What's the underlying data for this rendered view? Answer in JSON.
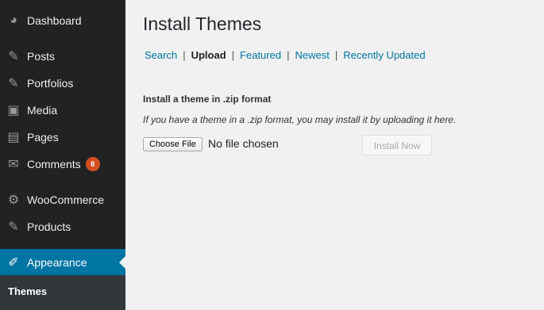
{
  "sidebar": {
    "items": [
      {
        "label": "Dashboard",
        "icon": "dashboard-icon",
        "glyph": "◕"
      },
      {
        "label": "Posts",
        "icon": "pin-icon",
        "glyph": "✎"
      },
      {
        "label": "Portfolios",
        "icon": "pin-icon",
        "glyph": "✎"
      },
      {
        "label": "Media",
        "icon": "media-icon",
        "glyph": "▣"
      },
      {
        "label": "Pages",
        "icon": "pages-icon",
        "glyph": "▤"
      },
      {
        "label": "Comments",
        "icon": "comment-icon",
        "glyph": "✉",
        "badge": "8"
      },
      {
        "label": "WooCommerce",
        "icon": "gear-icon",
        "glyph": "⚙"
      },
      {
        "label": "Products",
        "icon": "pin-icon",
        "glyph": "✎"
      },
      {
        "label": "Appearance",
        "icon": "paintbrush-icon",
        "glyph": "✐",
        "active": true
      }
    ],
    "submenu": {
      "current": "Themes"
    },
    "colors": {
      "background": "#222222",
      "active": "#0074a2",
      "badge": "#d54e21"
    }
  },
  "main": {
    "title": "Install Themes",
    "subnav": [
      {
        "label": "Search",
        "current": false
      },
      {
        "label": "Upload",
        "current": true
      },
      {
        "label": "Featured",
        "current": false
      },
      {
        "label": "Newest",
        "current": false
      },
      {
        "label": "Recently Updated",
        "current": false
      }
    ],
    "subnav_separator": "|",
    "upload": {
      "heading": "Install a theme in .zip format",
      "description": "If you have a theme in a .zip format, you may install it by uploading it here.",
      "choose_file_label": "Choose File",
      "file_status": "No file chosen",
      "install_label": "Install Now"
    }
  }
}
